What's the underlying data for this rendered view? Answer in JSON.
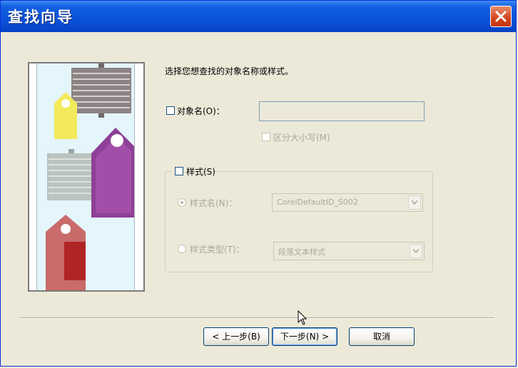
{
  "window": {
    "title": "查找向导",
    "close_icon": "close-icon"
  },
  "instruction": "选择您想查找的对象名称或样式。",
  "object_name": {
    "checkbox_label": "对象名(O)：",
    "value": "",
    "case_label": "区分大小写(M)"
  },
  "style": {
    "checkbox_label": "样式(S)",
    "style_name_label": "样式名(N)：",
    "style_name_value": "CorelDefaultID_S002",
    "style_type_label": "样式类型(T)：",
    "style_type_value": "段落文本样式"
  },
  "buttons": {
    "back": "< 上一步(B)",
    "next": "下一步(N) >",
    "cancel": "取消"
  },
  "colors": {
    "title_bar": "#0a52d9",
    "close_button": "#d4451d"
  }
}
